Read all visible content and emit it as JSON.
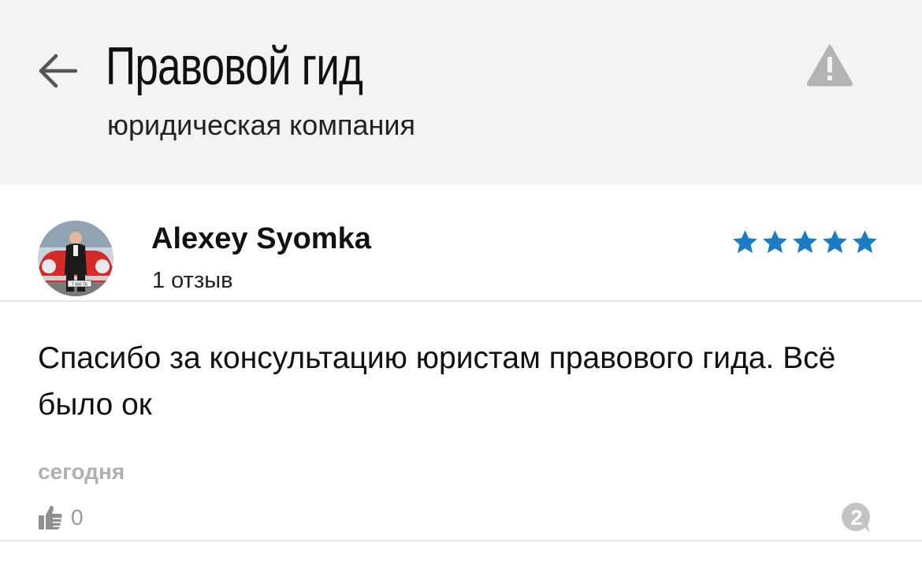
{
  "header": {
    "title": "Правовой гид",
    "subtitle": "юридическая компания"
  },
  "review": {
    "author": "Alexey Syomka",
    "review_count": "1 отзыв",
    "rating": 5,
    "rating_max": 5,
    "star_color": "#1a7cc4",
    "text": "Спасибо за консультацию юристам правового гида. Всё было ок",
    "date": "сегодня",
    "likes": "0",
    "comments_count": "2",
    "avatar_plate": "Т 666 ТК"
  },
  "icons": {
    "back": "arrow-left-icon",
    "report": "warning-icon",
    "like": "thumbs-up-icon",
    "comments": "comment-bubble-icon"
  }
}
